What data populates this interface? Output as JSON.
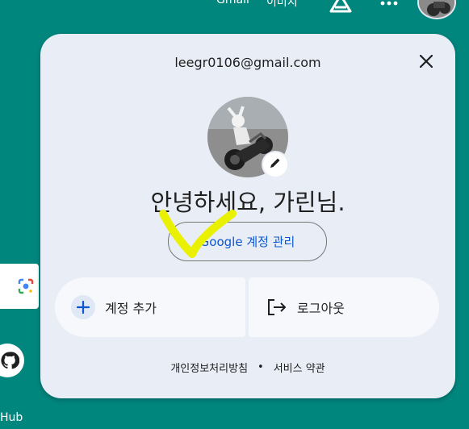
{
  "topbar": {
    "gmail": "Gmail",
    "images": "이미지"
  },
  "side": {
    "github_label": "Hub"
  },
  "account": {
    "email": "leegr0106@gmail.com",
    "greeting": "안녕하세요, 가린님.",
    "manage_button": "Google 계정 관리",
    "add_account": "계정 추가",
    "sign_out": "로그아웃",
    "privacy": "개인정보처리방침",
    "separator": "•",
    "terms": "서비스 약관"
  },
  "icons": {
    "close": "close-icon",
    "edit": "pencil-icon",
    "add": "plus-icon",
    "logout": "logout-icon",
    "apps": "apps-grid-icon",
    "labs": "labs-icon",
    "lens": "lens-icon",
    "github": "github-icon"
  },
  "colors": {
    "background": "#01867e",
    "panel": "#e8edf6",
    "link": "#0b57d0",
    "highlight": "#e9f000"
  }
}
